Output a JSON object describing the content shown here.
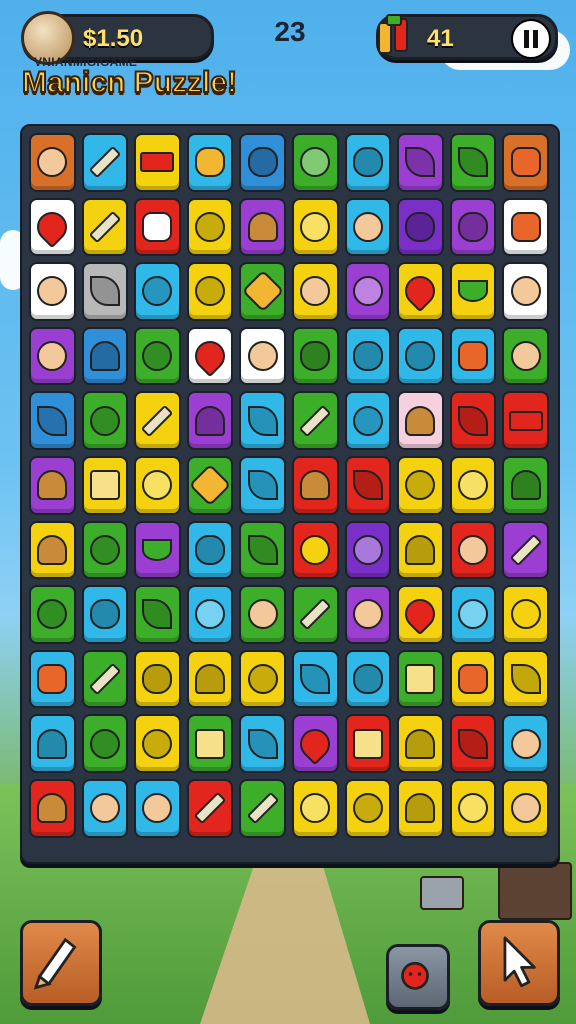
{
  "hud": {
    "money": "$1.50",
    "moves": "23",
    "score": "41"
  },
  "header": {
    "subtitle": "VNIANMIGIGAME",
    "title": "Manicn Puzzle!"
  },
  "icons": {
    "coin": "coin-icon",
    "tools": "tools-icon",
    "pause": "pause-icon",
    "pencil": "pencil-icon",
    "bomb": "bomb-icon",
    "cursor": "cursor-icon"
  },
  "board": {
    "rows": [
      [
        {
          "bg": "#d8702a",
          "g": "face"
        },
        {
          "bg": "#2fb8e8",
          "g": "pencil"
        },
        {
          "bg": "#f4d20f",
          "g": "bar"
        },
        {
          "bg": "#2fb8e8",
          "g": "dog"
        },
        {
          "bg": "#2f8fd8",
          "g": "blob"
        },
        {
          "bg": "#3cae2a",
          "g": "circle"
        },
        {
          "bg": "#2fb8e8",
          "g": "blob"
        },
        {
          "bg": "#9b3fd2",
          "g": "leaf"
        },
        {
          "bg": "#3cae2a",
          "g": "leaf"
        },
        {
          "bg": "#d8702a",
          "g": "splat"
        }
      ],
      [
        {
          "bg": "#ffffff",
          "g": "heart"
        },
        {
          "bg": "#f4d20f",
          "g": "pencil"
        },
        {
          "bg": "#e3261d",
          "g": "gear"
        },
        {
          "bg": "#f4d20f",
          "g": "apple"
        },
        {
          "bg": "#9b3fd2",
          "g": "shell"
        },
        {
          "bg": "#f4d20f",
          "g": "circle"
        },
        {
          "bg": "#2fb8e8",
          "g": "face"
        },
        {
          "bg": "#7a30c8",
          "g": "blob"
        },
        {
          "bg": "#9b3fd2",
          "g": "blob"
        },
        {
          "bg": "#ffffff",
          "g": "splat"
        }
      ],
      [
        {
          "bg": "#ffffff",
          "g": "face"
        },
        {
          "bg": "#b8b8b8",
          "g": "leaf"
        },
        {
          "bg": "#2fb8e8",
          "g": "apple"
        },
        {
          "bg": "#f4d20f",
          "g": "apple"
        },
        {
          "bg": "#3cae2a",
          "g": "star"
        },
        {
          "bg": "#f4d20f",
          "g": "face"
        },
        {
          "bg": "#9b3fd2",
          "g": "circle"
        },
        {
          "bg": "#f4d20f",
          "g": "heart"
        },
        {
          "bg": "#f4d20f",
          "g": "bowl"
        },
        {
          "bg": "#ffffff",
          "g": "face"
        }
      ],
      [
        {
          "bg": "#9b3fd2",
          "g": "face"
        },
        {
          "bg": "#2f8fd8",
          "g": "cone"
        },
        {
          "bg": "#3cae2a",
          "g": "apple"
        },
        {
          "bg": "#ffffff",
          "g": "heart"
        },
        {
          "bg": "#ffffff",
          "g": "face"
        },
        {
          "bg": "#3cae2a",
          "g": "blob"
        },
        {
          "bg": "#2fb8e8",
          "g": "blob"
        },
        {
          "bg": "#2fb8e8",
          "g": "blob"
        },
        {
          "bg": "#2fb8e8",
          "g": "splat"
        },
        {
          "bg": "#3cae2a",
          "g": "face"
        }
      ],
      [
        {
          "bg": "#2f8fd8",
          "g": "leaf"
        },
        {
          "bg": "#3cae2a",
          "g": "apple"
        },
        {
          "bg": "#f4d20f",
          "g": "pencil"
        },
        {
          "bg": "#9b3fd2",
          "g": "cone"
        },
        {
          "bg": "#2fb8e8",
          "g": "leaf"
        },
        {
          "bg": "#3cae2a",
          "g": "pencil"
        },
        {
          "bg": "#2fb8e8",
          "g": "apple"
        },
        {
          "bg": "#f7d0e0",
          "g": "shell"
        },
        {
          "bg": "#e3261d",
          "g": "leaf"
        },
        {
          "bg": "#e3261d",
          "g": "bar"
        }
      ],
      [
        {
          "bg": "#9b3fd2",
          "g": "shell"
        },
        {
          "bg": "#f4d20f",
          "g": "box"
        },
        {
          "bg": "#f4d20f",
          "g": "circle"
        },
        {
          "bg": "#3cae2a",
          "g": "star"
        },
        {
          "bg": "#2fb8e8",
          "g": "leaf"
        },
        {
          "bg": "#e3261d",
          "g": "shell"
        },
        {
          "bg": "#e3261d",
          "g": "leaf"
        },
        {
          "bg": "#f4d20f",
          "g": "apple"
        },
        {
          "bg": "#f4d20f",
          "g": "circle"
        },
        {
          "bg": "#3cae2a",
          "g": "cone"
        }
      ],
      [
        {
          "bg": "#f4d20f",
          "g": "shell"
        },
        {
          "bg": "#3cae2a",
          "g": "apple"
        },
        {
          "bg": "#9b3fd2",
          "g": "bowl"
        },
        {
          "bg": "#2fb8e8",
          "g": "blob"
        },
        {
          "bg": "#3cae2a",
          "g": "leaf"
        },
        {
          "bg": "#e3261d",
          "g": "moon"
        },
        {
          "bg": "#7a30c8",
          "g": "circle"
        },
        {
          "bg": "#f4d20f",
          "g": "cone"
        },
        {
          "bg": "#e3261d",
          "g": "face"
        },
        {
          "bg": "#9b3fd2",
          "g": "pencil"
        }
      ],
      [
        {
          "bg": "#3cae2a",
          "g": "apple"
        },
        {
          "bg": "#2fb8e8",
          "g": "blob"
        },
        {
          "bg": "#3cae2a",
          "g": "leaf"
        },
        {
          "bg": "#2fb8e8",
          "g": "circle"
        },
        {
          "bg": "#3cae2a",
          "g": "face"
        },
        {
          "bg": "#3cae2a",
          "g": "pencil"
        },
        {
          "bg": "#9b3fd2",
          "g": "face"
        },
        {
          "bg": "#f4d20f",
          "g": "heart"
        },
        {
          "bg": "#2fb8e8",
          "g": "circle"
        },
        {
          "bg": "#f4d20f",
          "g": "ring"
        }
      ],
      [
        {
          "bg": "#2fb8e8",
          "g": "splat"
        },
        {
          "bg": "#3cae2a",
          "g": "pencil"
        },
        {
          "bg": "#f4d20f",
          "g": "blob"
        },
        {
          "bg": "#f4d20f",
          "g": "cone"
        },
        {
          "bg": "#f4d20f",
          "g": "apple"
        },
        {
          "bg": "#2fb8e8",
          "g": "leaf"
        },
        {
          "bg": "#2fb8e8",
          "g": "blob"
        },
        {
          "bg": "#3cae2a",
          "g": "box"
        },
        {
          "bg": "#f4d20f",
          "g": "splat"
        },
        {
          "bg": "#f4d20f",
          "g": "leaf"
        }
      ],
      [
        {
          "bg": "#2fb8e8",
          "g": "cone"
        },
        {
          "bg": "#3cae2a",
          "g": "apple"
        },
        {
          "bg": "#f4d20f",
          "g": "apple"
        },
        {
          "bg": "#3cae2a",
          "g": "box"
        },
        {
          "bg": "#2fb8e8",
          "g": "leaf"
        },
        {
          "bg": "#9b3fd2",
          "g": "heart"
        },
        {
          "bg": "#e3261d",
          "g": "box"
        },
        {
          "bg": "#f4d20f",
          "g": "cone"
        },
        {
          "bg": "#e3261d",
          "g": "leaf"
        },
        {
          "bg": "#2fb8e8",
          "g": "face"
        }
      ],
      [
        {
          "bg": "#e3261d",
          "g": "shell"
        },
        {
          "bg": "#2fb8e8",
          "g": "face"
        },
        {
          "bg": "#2fb8e8",
          "g": "face"
        },
        {
          "bg": "#e3261d",
          "g": "pencil"
        },
        {
          "bg": "#3cae2a",
          "g": "pencil"
        },
        {
          "bg": "#f4d20f",
          "g": "circle"
        },
        {
          "bg": "#f4d20f",
          "g": "apple"
        },
        {
          "bg": "#f4d20f",
          "g": "cone"
        },
        {
          "bg": "#f4d20f",
          "g": "circle"
        },
        {
          "bg": "#f4d20f",
          "g": "face"
        }
      ]
    ]
  }
}
